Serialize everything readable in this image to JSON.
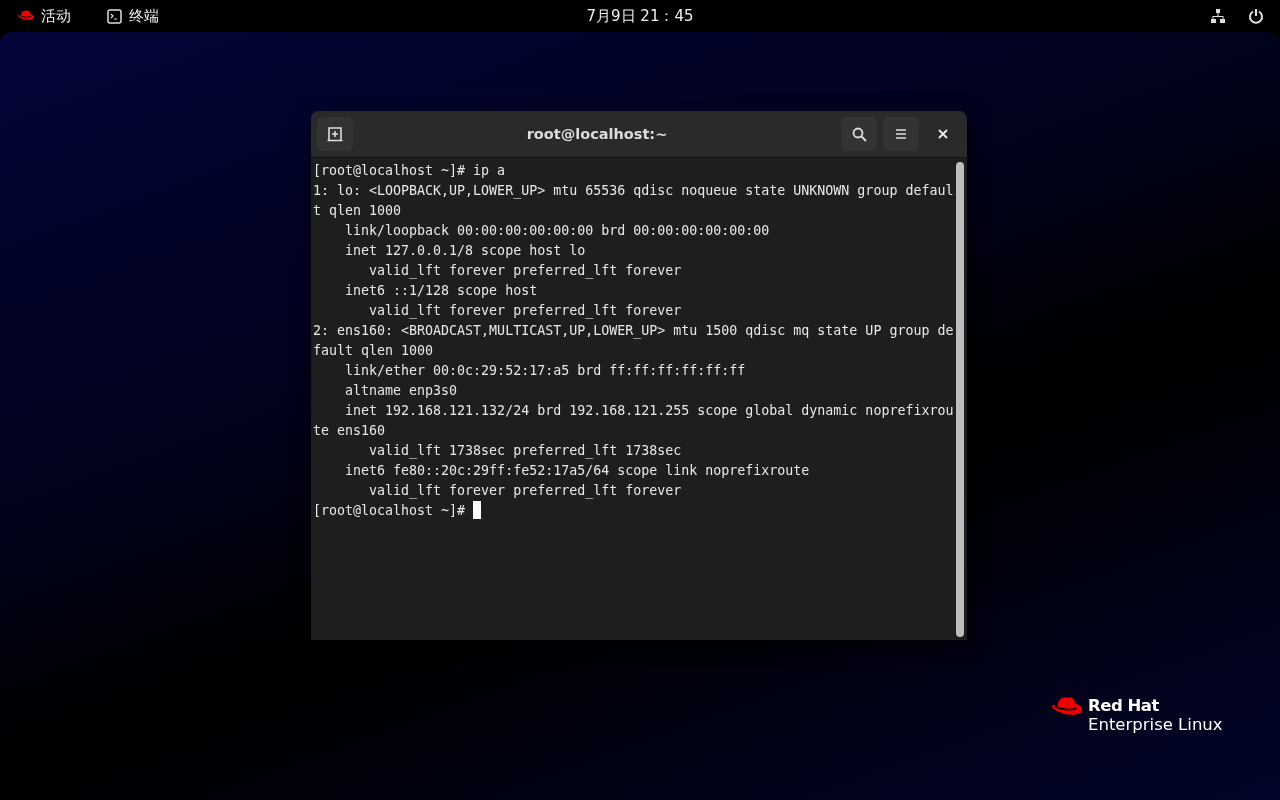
{
  "top_bar": {
    "activities": "活动",
    "app_name": "终端",
    "clock": "7月9日  21：45"
  },
  "terminal": {
    "title": "root@localhost:~",
    "cursor_visible": true,
    "lines": [
      "[root@localhost ~]# ip a",
      "1: lo: <LOOPBACK,UP,LOWER_UP> mtu 65536 qdisc noqueue state UNKNOWN group defaul",
      "t qlen 1000",
      "    link/loopback 00:00:00:00:00:00 brd 00:00:00:00:00:00",
      "    inet 127.0.0.1/8 scope host lo",
      "       valid_lft forever preferred_lft forever",
      "    inet6 ::1/128 scope host",
      "       valid_lft forever preferred_lft forever",
      "2: ens160: <BROADCAST,MULTICAST,UP,LOWER_UP> mtu 1500 qdisc mq state UP group de",
      "fault qlen 1000",
      "    link/ether 00:0c:29:52:17:a5 brd ff:ff:ff:ff:ff:ff",
      "    altname enp3s0",
      "    inet 192.168.121.132/24 brd 192.168.121.255 scope global dynamic noprefixrou",
      "te ens160",
      "       valid_lft 1738sec preferred_lft 1738sec",
      "    inet6 fe80::20c:29ff:fe52:17a5/64 scope link noprefixroute",
      "       valid_lft forever preferred_lft forever",
      "[root@localhost ~]# "
    ]
  },
  "logo": {
    "line_1": "Red Hat",
    "line_2": "Enterprise Linux"
  }
}
